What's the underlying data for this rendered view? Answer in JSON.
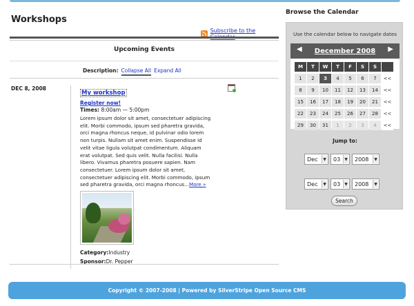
{
  "page": {
    "title": "Workshops",
    "rss_label": "Subscribe to the Calendar",
    "section_title": "Upcoming Events",
    "description_label": "Description:",
    "collapse_all": "Collapse All",
    "expand_all": "Expand All"
  },
  "event": {
    "date": "DEC 8, 2008",
    "title": "My workshop",
    "register": "Register now!",
    "times_label": "Times:",
    "times_value": "8:00am — 5:00pm",
    "body": "Lorem ipsum dolor sit amet, consectetuer adipiscing elit. Morbi commodo, ipsum sed pharetra gravida, orci magna rhoncus neque, id pulvinar odio lorem non turpis. Nullam sit amet enim. Suspendisse id velit vitae ligula volutpat condimentum. Aliquam erat volutpat. Sed quis velit. Nulla facilisi. Nulla libero. Vivamus pharetra posuere sapien. Nam consectetuer. Lorem ipsum dolor sit amet, consectetuer adipiscing elit. Morbi commodo, ipsum sed pharetra gravida, orci magna rhoncus...",
    "more": "More »",
    "category_label": "Category:",
    "category_value": "Industry",
    "sponsor_label": "Sponsor:",
    "sponsor_value": "Dr. Pepper"
  },
  "sidebar": {
    "title": "Browse the Calendar",
    "hint": "Use the calendar below to navigate dates",
    "calendar": {
      "prev": "◀",
      "next": "▶",
      "month": "December 2008",
      "week_marker": "<<",
      "headers": [
        "M",
        "T",
        "W",
        "T",
        "F",
        "S",
        "S",
        ""
      ],
      "weeks": [
        [
          {
            "d": "1"
          },
          {
            "d": "2"
          },
          {
            "d": "3",
            "today": true
          },
          {
            "d": "4"
          },
          {
            "d": "5"
          },
          {
            "d": "6"
          },
          {
            "d": "7"
          }
        ],
        [
          {
            "d": "8"
          },
          {
            "d": "9"
          },
          {
            "d": "10"
          },
          {
            "d": "11"
          },
          {
            "d": "12"
          },
          {
            "d": "13"
          },
          {
            "d": "14"
          }
        ],
        [
          {
            "d": "15"
          },
          {
            "d": "16"
          },
          {
            "d": "17"
          },
          {
            "d": "18"
          },
          {
            "d": "19"
          },
          {
            "d": "20"
          },
          {
            "d": "21"
          }
        ],
        [
          {
            "d": "22"
          },
          {
            "d": "23"
          },
          {
            "d": "24"
          },
          {
            "d": "25"
          },
          {
            "d": "26"
          },
          {
            "d": "27"
          },
          {
            "d": "28"
          }
        ],
        [
          {
            "d": "29"
          },
          {
            "d": "30"
          },
          {
            "d": "31"
          },
          {
            "d": "1",
            "other": true
          },
          {
            "d": "2",
            "other": true
          },
          {
            "d": "3",
            "other": true
          },
          {
            "d": "4",
            "other": true
          }
        ]
      ]
    },
    "jump_label": "Jump to:",
    "jump_row1": {
      "month": "Dec",
      "day": "03",
      "year": "2008"
    },
    "jump_row2": {
      "month": "Dec",
      "day": "03",
      "year": "2008"
    },
    "search_label": "Search"
  },
  "footer": {
    "text": "Copyright © 2007-2008 | Powered by SilverStripe Open Source CMS"
  }
}
